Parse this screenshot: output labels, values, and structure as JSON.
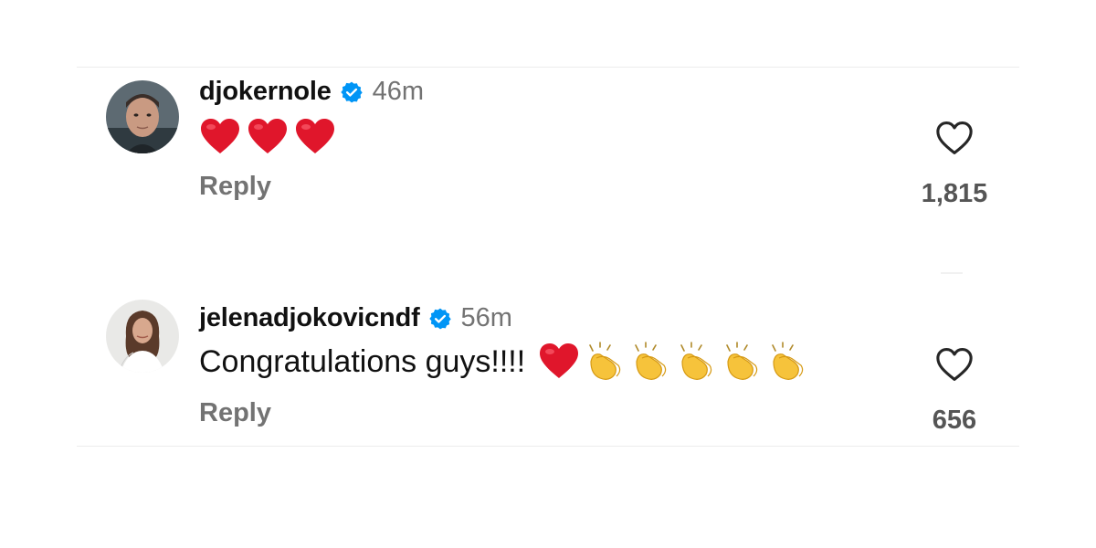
{
  "comments": [
    {
      "username": "djokernole",
      "time": "46m",
      "text": "",
      "emojis": [
        "red-heart",
        "red-heart",
        "red-heart"
      ],
      "reply_label": "Reply",
      "likes": "1,815"
    },
    {
      "username": "jelenadjokovicndf",
      "time": "56m",
      "text": "Congratulations guys!!!!",
      "emojis": [
        "red-heart",
        "clapping-hands",
        "clapping-hands",
        "clapping-hands",
        "clapping-hands",
        "clapping-hands"
      ],
      "reply_label": "Reply",
      "likes": "656"
    }
  ],
  "colors": {
    "verified_blue": "#0095f6",
    "secondary_text": "#737373",
    "heart_red": "#e0162b",
    "clap_yellow": "#f6c33b"
  }
}
